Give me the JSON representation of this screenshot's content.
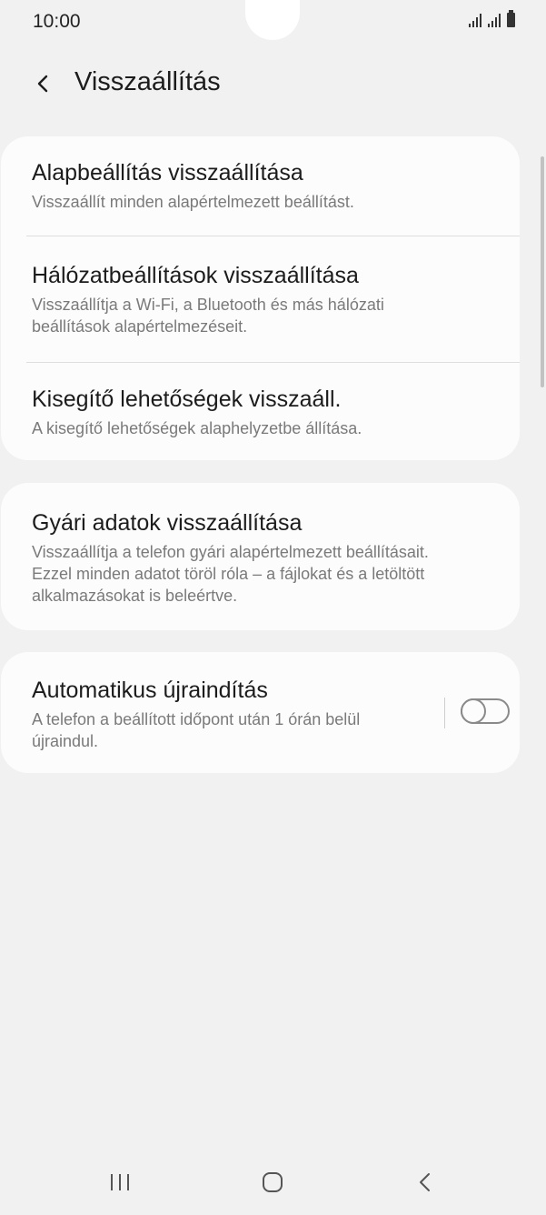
{
  "status_bar": {
    "time": "10:00"
  },
  "header": {
    "title": "Visszaállítás",
    "back_icon": "chevron-left-icon"
  },
  "cards": {
    "reset_group": {
      "items": [
        {
          "title": "Alapbeállítás visszaállítása",
          "desc": "Visszaállít minden alapértelmezett beállítást."
        },
        {
          "title": "Hálózatbeállítások visszaállítása",
          "desc_line1": "Visszaállítja a Wi-Fi, a Bluetooth és más hálózati",
          "desc_line2": "beállítások alapértelmezéseit."
        },
        {
          "title": "Kisegítő lehetőségek visszaáll.",
          "desc": "A kisegítő lehetőségek alaphelyzetbe állítása."
        }
      ]
    },
    "factory_reset": {
      "title": "Gyári adatok visszaállítása",
      "desc_line1": "Visszaállítja a telefon gyári alapértelmezett beállításait.",
      "desc_line2": "Ezzel minden adatot töröl róla – a fájlokat és a letöltött",
      "desc_line3": "alkalmazásokat is beleértve."
    },
    "auto_restart": {
      "title": "Automatikus újraindítás",
      "desc_line1": "A telefon a beállított időpont után 1 órán belül",
      "desc_line2": "újraindul.",
      "toggle_on": false
    }
  },
  "nav_bar": {
    "recent_icon": "recent-apps-icon",
    "home_icon": "home-icon",
    "back_icon": "back-icon"
  },
  "colors": {
    "background": "#f1f1f1",
    "card": "#fcfcfc",
    "title_text": "#1c1c1c",
    "secondary_text": "#7a7a7a"
  }
}
